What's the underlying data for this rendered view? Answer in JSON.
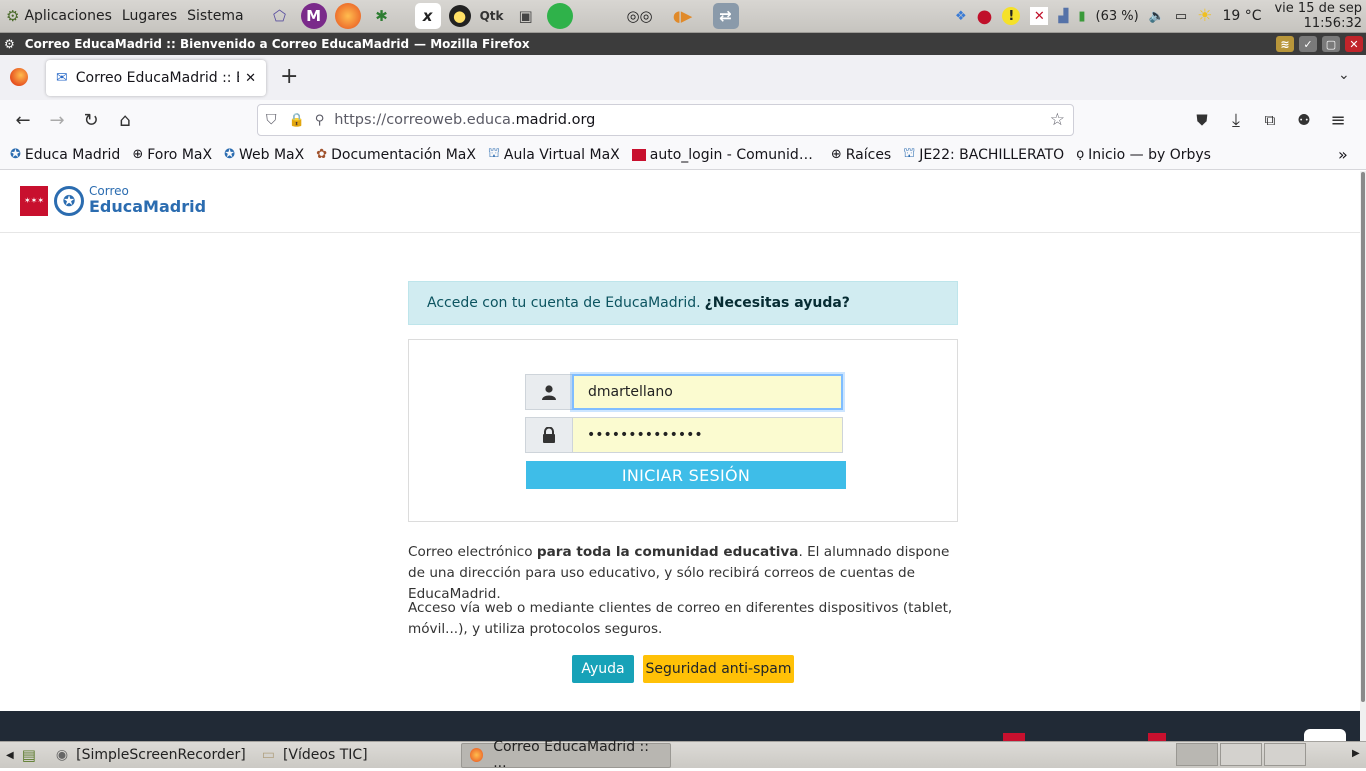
{
  "system_panel": {
    "menus": [
      "Aplicaciones",
      "Lugares",
      "Sistema"
    ],
    "battery": "(63 %)",
    "weather": "19 °C",
    "date": "vie 15 de sep",
    "time": "11:56:32"
  },
  "window": {
    "title": "Correo EducaMadrid :: Bienvenido a Correo EducaMadrid",
    "title_suffix": "— Mozilla Firefox"
  },
  "browser": {
    "tab_title": "Correo EducaMadrid :: Bi",
    "url_prefix": "https://correoweb.educa.",
    "url_domain": "madrid.org",
    "bookmarks": [
      {
        "label": "Educa Madrid",
        "icon": "educamadrid-icon"
      },
      {
        "label": "Foro MaX",
        "icon": "globe-icon"
      },
      {
        "label": "Web MaX",
        "icon": "educamadrid-icon"
      },
      {
        "label": "Documentación MaX",
        "icon": "gear-icon"
      },
      {
        "label": "Aula Virtual MaX",
        "icon": "graduation-cap-icon"
      },
      {
        "label": "auto_login - Comunid…",
        "icon": "madrid-flag-icon"
      },
      {
        "label": "Raíces",
        "icon": "globe-icon"
      },
      {
        "label": "JE22: BACHILLERATO",
        "icon": "graduation-cap-icon"
      },
      {
        "label": "Inicio — by Orbys",
        "icon": "orbys-icon"
      }
    ]
  },
  "site": {
    "logo_small": "Correo",
    "logo_big": "EducaMadrid",
    "alert_text": "Accede con tu cuenta de EducaMadrid.",
    "alert_link": "¿Necesitas ayuda?",
    "username_value": "dmartellano",
    "password_value": "••••••••••••••",
    "login_button": "INICIAR SESIÓN",
    "info1_a": "Correo electrónico ",
    "info1_b": "para toda la comunidad educativa",
    "info1_c": ". El alumnado dispone de una dirección para uso educativo, y sólo recibirá correos de cuentas de EducaMadrid.",
    "info2": "Acceso vía web o mediante clientes de correo en diferentes dispositivos (tablet, móvil...), y utiliza protocolos seguros.",
    "help_button": "Ayuda",
    "spam_button": "Seguridad anti-spam"
  },
  "taskbar": {
    "tasks": [
      "[SimpleScreenRecorder]",
      "[Vídeos TIC]",
      "Correo EducaMadrid :: ..."
    ]
  },
  "colors": {
    "alert_bg": "#d1ecf1",
    "login_button": "#3ebde8",
    "help_button": "#17a2b8",
    "spam_button": "#ffc107",
    "brand_blue": "#2b6cb0",
    "madrid_red": "#c8102e"
  }
}
